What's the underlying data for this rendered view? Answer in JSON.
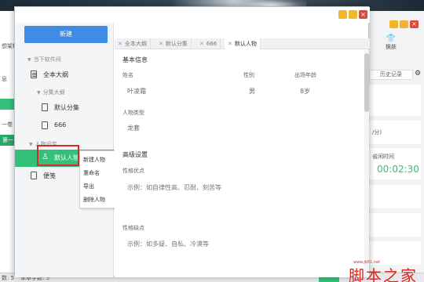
{
  "background_app": {
    "left_texts": [
      "想架构",
      "息",
      "一卷",
      "第一"
    ],
    "skin_label": "换肤",
    "history_label": "历史记录",
    "rate_text": "/分)",
    "timer_label": "省闲时间",
    "timer_value": "00:02:30",
    "status_left": "数: 5",
    "status_chapter": "本章字数: 5"
  },
  "dialog": {
    "new_button": "新建",
    "sidebar": {
      "section_local": "当下软件间",
      "item_outline": "全本大纲",
      "section_chapters": "分集大纲",
      "item_default_chapter": "默认分集",
      "item_666": "666",
      "section_characters": "人物设定",
      "item_default_character": "默认人物",
      "item_notes": "便笺"
    },
    "context_menu": [
      "新建人物",
      "重命名",
      "导出",
      "删除人物"
    ],
    "tabs": [
      {
        "label": "全本大纲",
        "active": false
      },
      {
        "label": "默认分集",
        "active": false
      },
      {
        "label": "666",
        "active": false
      },
      {
        "label": "默认人物",
        "active": true
      }
    ],
    "content": {
      "basic_info_title": "基本信息",
      "name_label": "姓名",
      "gender_label": "性别",
      "age_label": "出场年龄",
      "name_value": "叶凌霜",
      "gender_value": "男",
      "age_value": "8岁",
      "type_label": "人物类型",
      "type_value": "龙套",
      "advanced_title": "高级设置",
      "strengths_label": "性格优点",
      "strengths_placeholder": "示例：如自律性高、忍耐、刻苦等",
      "weakness_label": "性格缺点",
      "weakness_placeholder": "示例：如多疑、自私、冷漠等"
    }
  },
  "watermark": {
    "text": "脚本之家",
    "url": "www.jb51.net"
  },
  "colors": {
    "accent_green": "#35c07a",
    "button_blue": "#3f8be6",
    "highlight_red": "#d72a2a"
  }
}
